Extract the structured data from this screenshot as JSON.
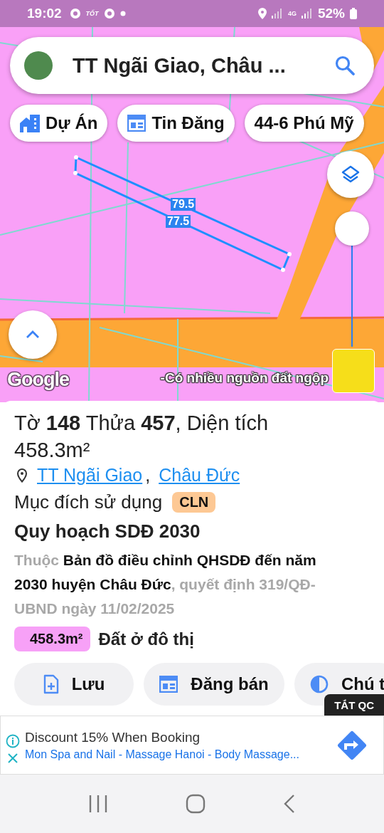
{
  "status_bar": {
    "time": "19:02",
    "notification_label": "TỐT",
    "network": "4G",
    "battery": "52%"
  },
  "search": {
    "value": "TT Ngãi Giao, Châu ..."
  },
  "chips": [
    {
      "label": "Dự Án",
      "kind": "project"
    },
    {
      "label": "Tin Đăng",
      "kind": "listing"
    },
    {
      "label": "44-6 Phú Mỹ",
      "kind": "place"
    }
  ],
  "map": {
    "edge_labels": [
      "79.5",
      "77.5"
    ],
    "opacity_slider": {
      "level": 1
    },
    "attribution": "Google",
    "banner_text": "-Có nhiều nguồn đất ngộp"
  },
  "parcel": {
    "title": "Tờ **148** Thửa **457**, Diện tích 458.3m²",
    "location_links": [
      "TT Ngãi Giao",
      "Châu Đức"
    ],
    "location_separator": ",",
    "purpose_label": "Mục đích sử dụng",
    "purpose_code": "CLN"
  },
  "plan": {
    "heading": "Quy hoạch SDĐ 2030",
    "description": "Thuộc **Bản đồ điều chỉnh QHSDĐ đến năm 2030 huyện Châu Đức**, quyết định 319/QĐ-UBND ngày 11/02/2025",
    "zones": [
      {
        "area": "458.3m²",
        "name": "Đất ở đô thị",
        "color": "#f7a1f7"
      }
    ]
  },
  "actions": [
    {
      "label": "Lưu",
      "kind": "save"
    },
    {
      "label": "Đăng bán",
      "kind": "post"
    },
    {
      "label": "Chú t",
      "kind": "note"
    }
  ],
  "ad": {
    "close_label": "TẮT QC",
    "title": "Discount 15% When Booking",
    "subtitle": "Mon Spa and Nail - Massage Hanoi - Body Massage..."
  }
}
